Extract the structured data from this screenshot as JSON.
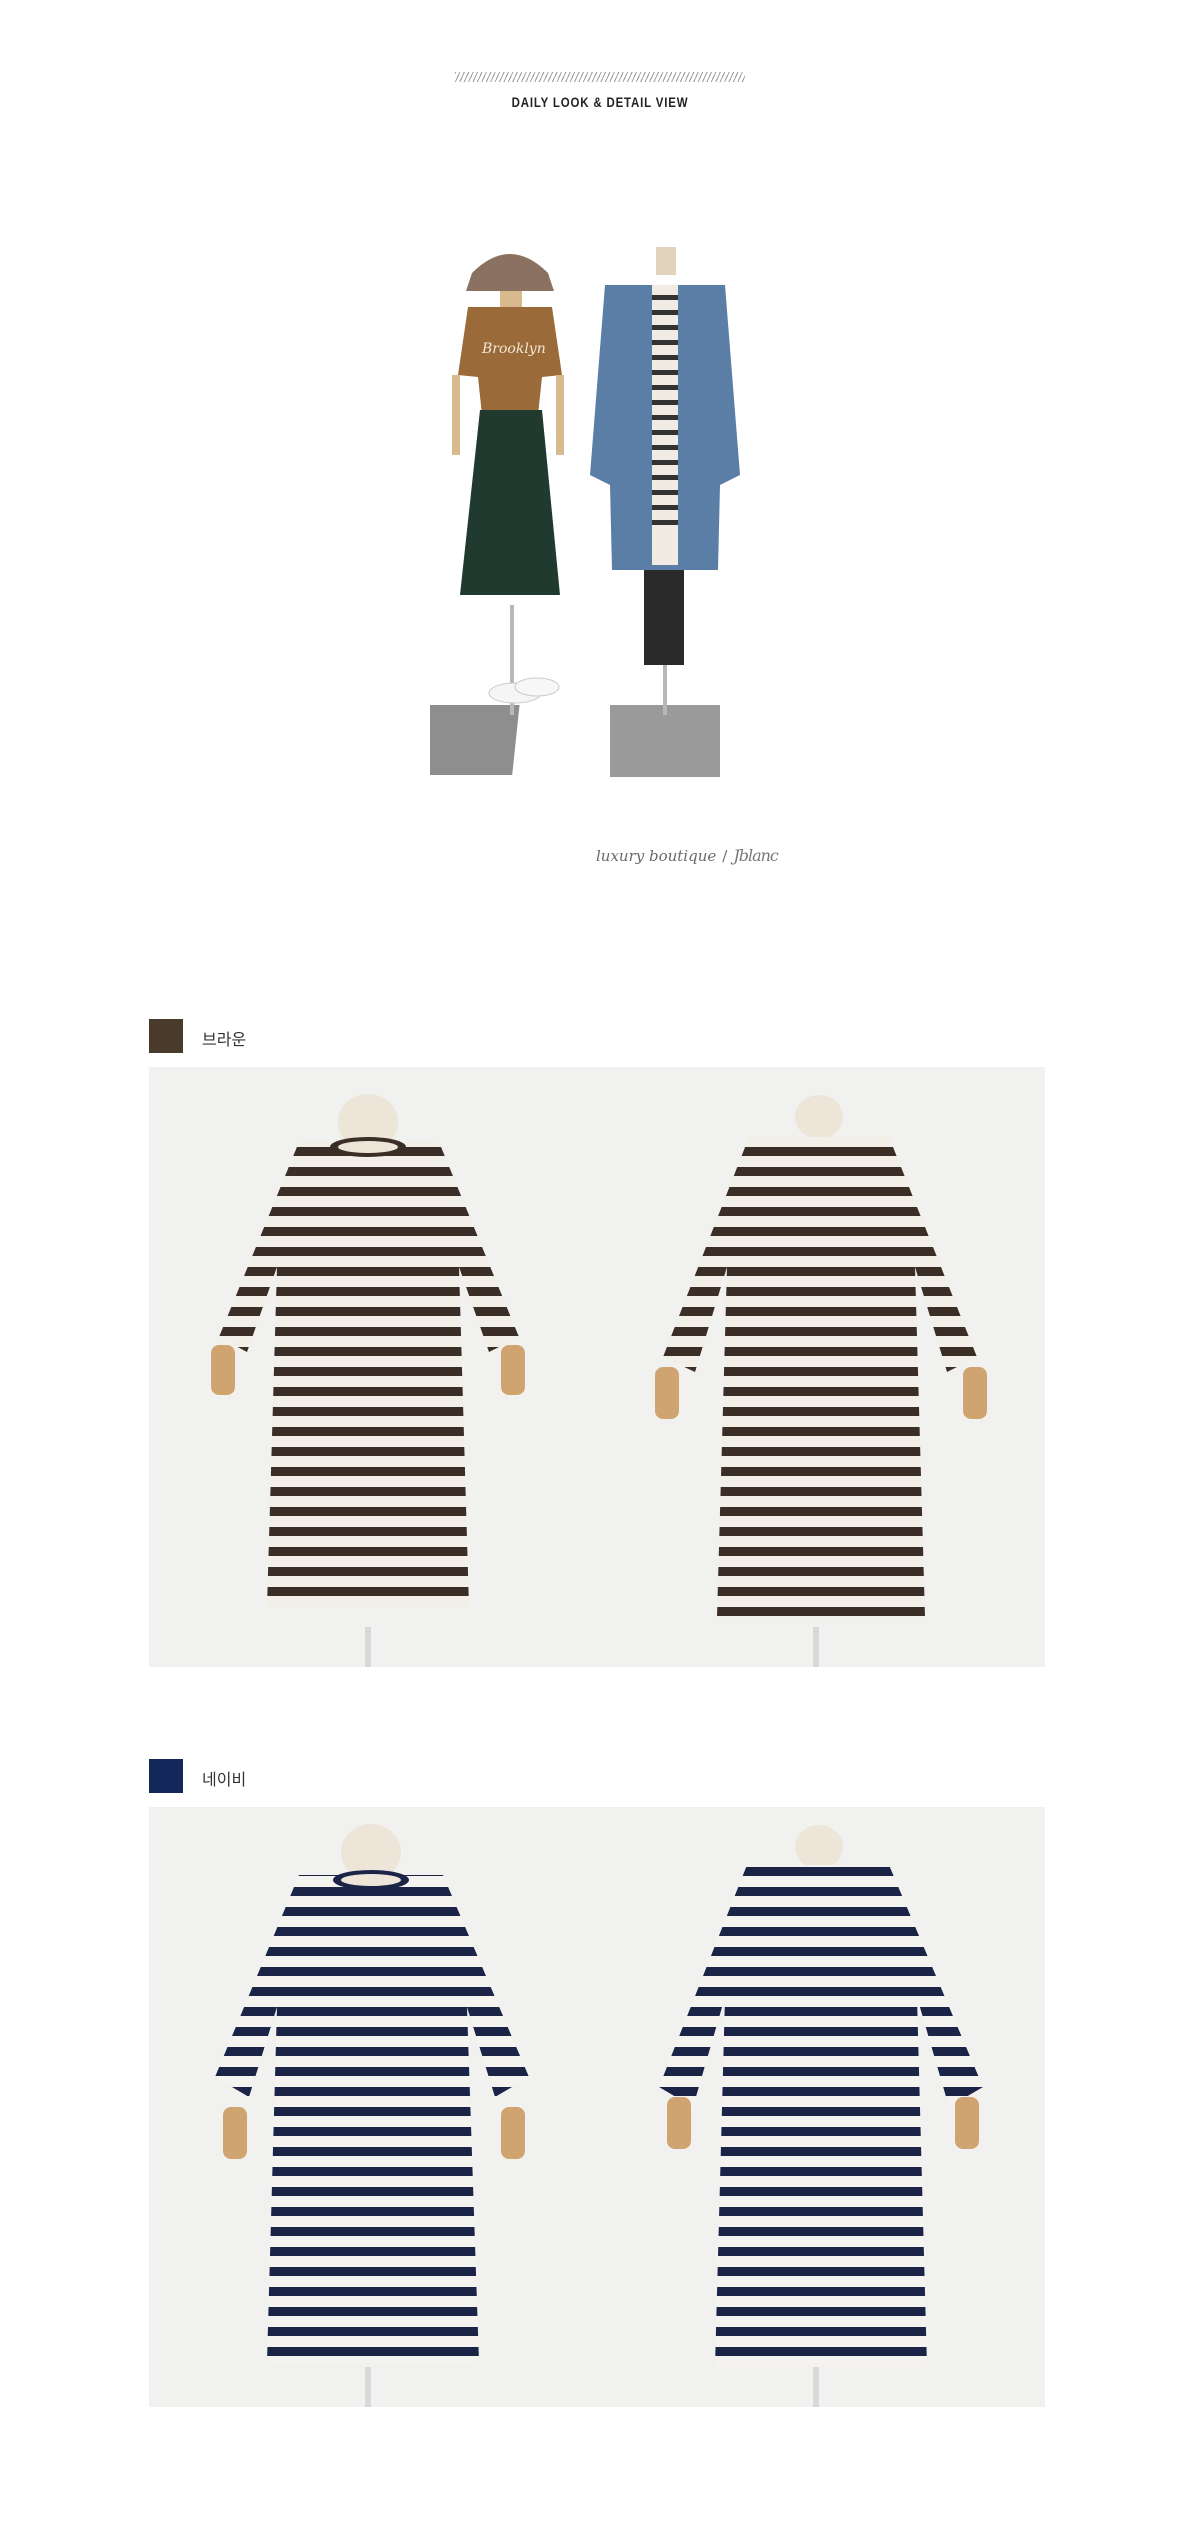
{
  "header": {
    "title": "DAILY LOOK & DETAIL VIEW"
  },
  "signature": {
    "text": "luxury boutique",
    "slash": "/",
    "script": "Jblanc"
  },
  "colors": [
    {
      "name": "브라운",
      "hex": "#4a3a2c",
      "stripe": "#3a2e26"
    },
    {
      "name": "네이비",
      "hex": "#13275a",
      "stripe": "#1b2447"
    }
  ],
  "photos": [
    {
      "color": "브라운",
      "view": "front-icon"
    },
    {
      "color": "브라운",
      "view": "back-icon"
    },
    {
      "color": "네이비",
      "view": "front-icon"
    },
    {
      "color": "네이비",
      "view": "back-icon"
    }
  ]
}
